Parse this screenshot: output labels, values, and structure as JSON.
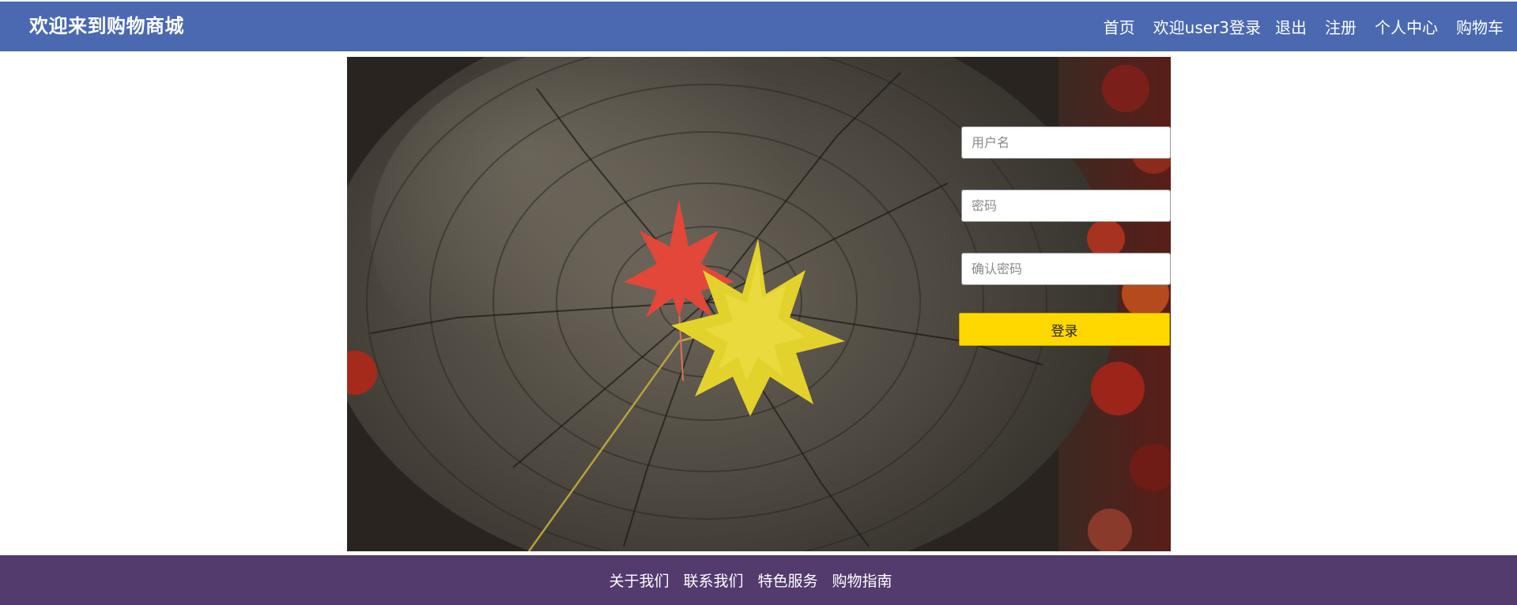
{
  "header": {
    "brand": "欢迎来到购物商城",
    "nav": [
      {
        "label": "首页"
      },
      {
        "label": "欢迎user3登录"
      },
      {
        "label": "退出"
      },
      {
        "label": "注册"
      },
      {
        "label": "个人中心"
      },
      {
        "label": "购物车"
      }
    ],
    "bg_color": "#4a69b1"
  },
  "hero": {
    "image": "autumn-leaves-on-tree-stump-photo"
  },
  "login_form": {
    "username_placeholder": "用户名",
    "password_placeholder": "密码",
    "confirm_placeholder": "确认密码",
    "username_value": "",
    "password_value": "",
    "confirm_value": "",
    "submit_label": "登录",
    "submit_color": "#ffd800"
  },
  "footer": {
    "links": [
      {
        "label": "关于我们"
      },
      {
        "label": "联系我们"
      },
      {
        "label": "特色服务"
      },
      {
        "label": "购物指南"
      }
    ],
    "bg_color": "#533b6e"
  }
}
